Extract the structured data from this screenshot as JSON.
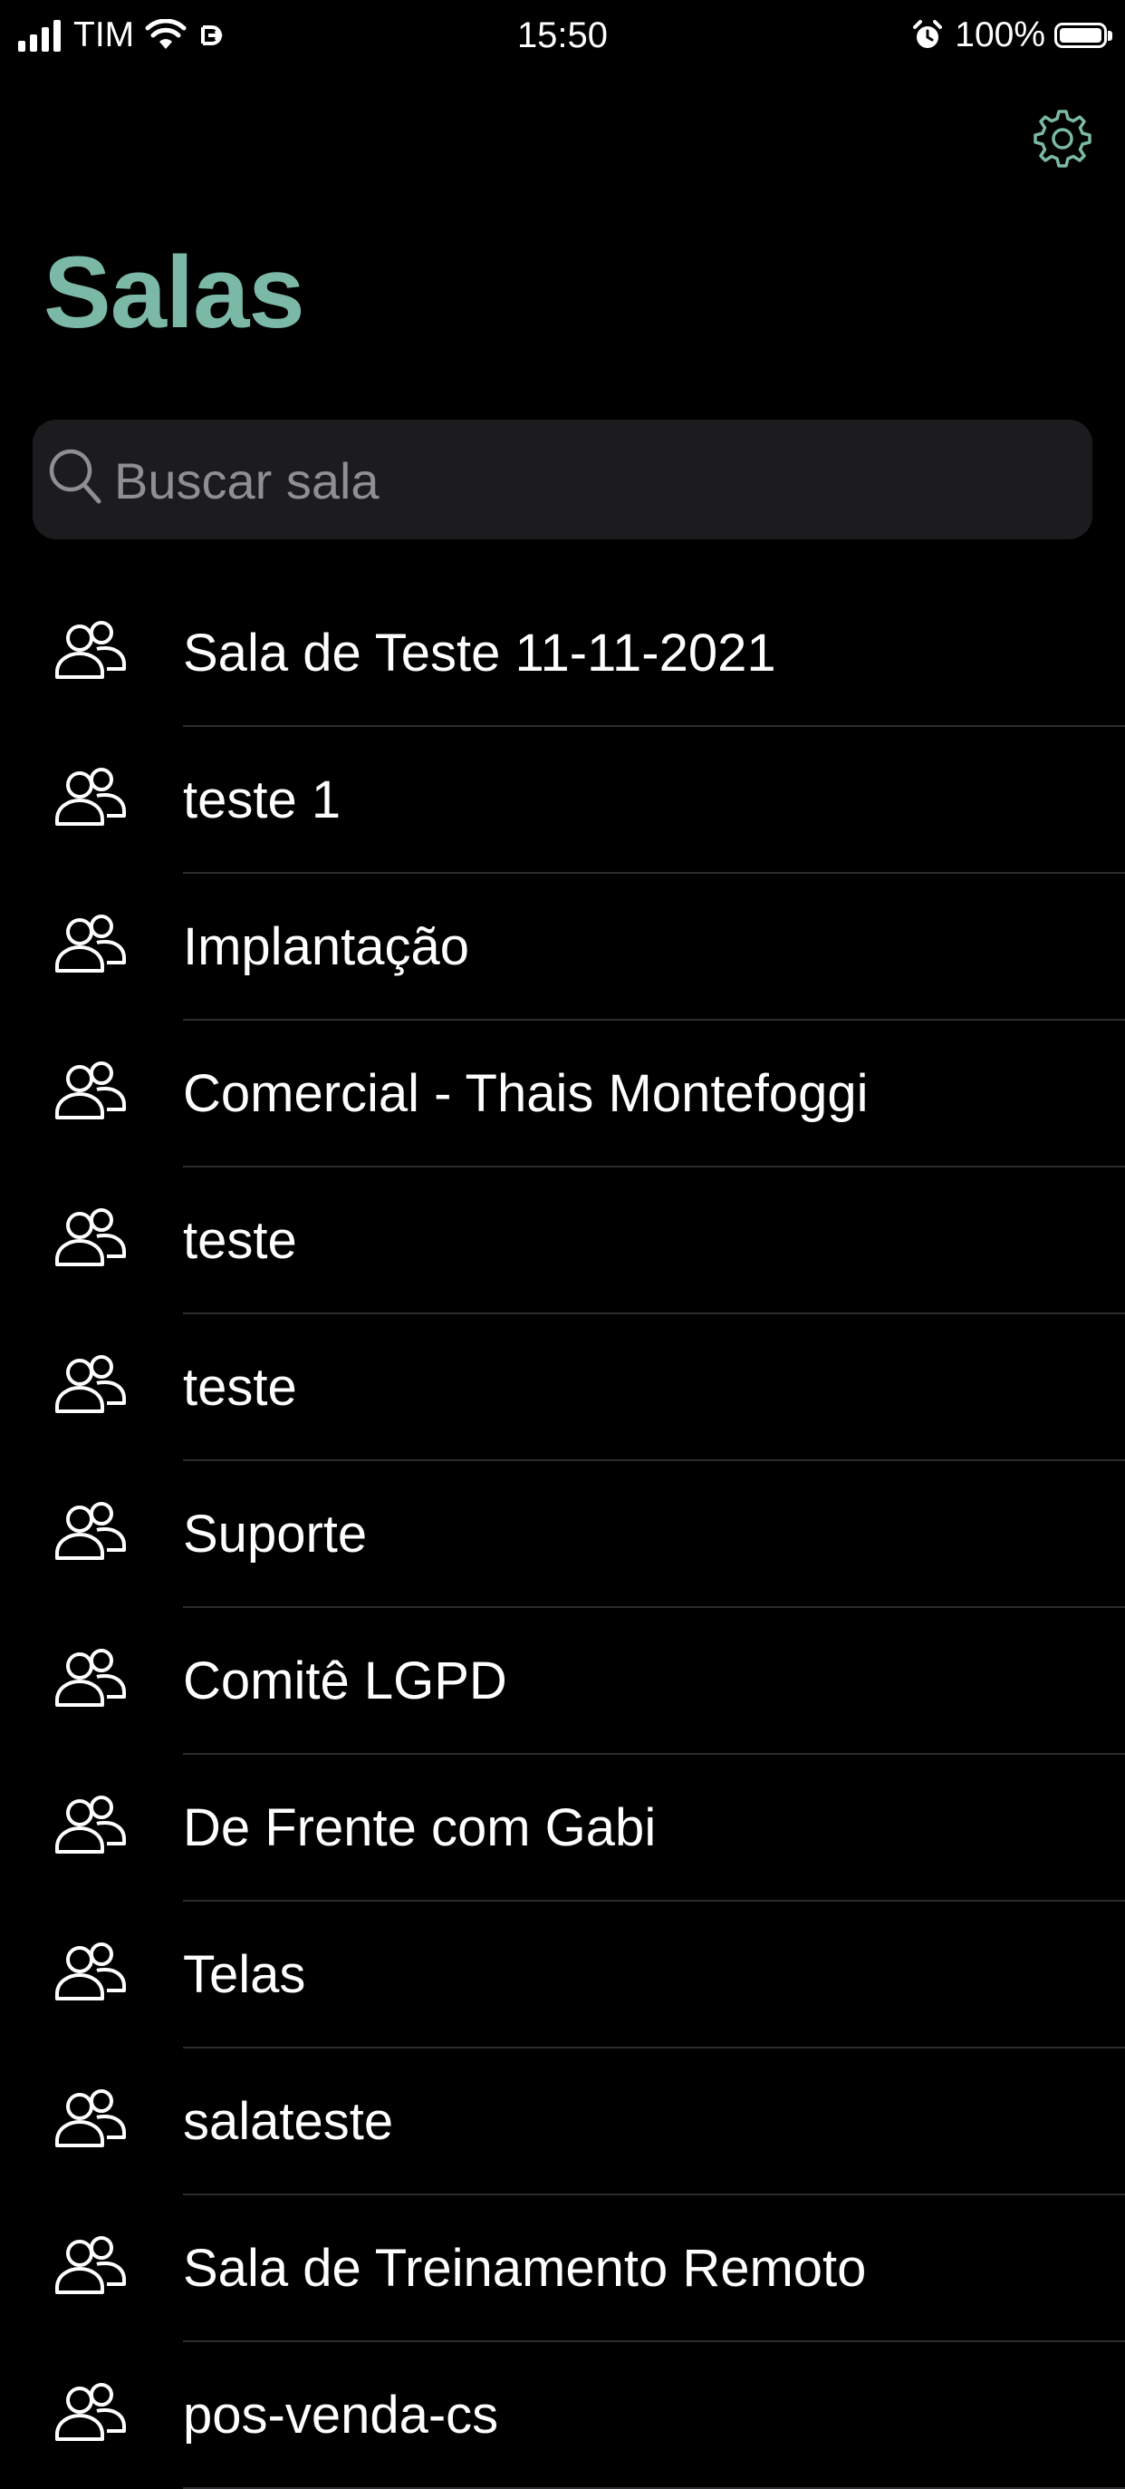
{
  "status_bar": {
    "carrier": "TIM",
    "time": "15:50",
    "battery_percent": "100%"
  },
  "header": {
    "title": "Salas",
    "settings_icon": "gear-icon",
    "accent_color": "#7bb8a6"
  },
  "search": {
    "placeholder": "Buscar sala",
    "value": ""
  },
  "rooms": [
    {
      "name": "Sala de Teste 11-11-2021",
      "icon": "people-icon"
    },
    {
      "name": "teste 1",
      "icon": "people-icon"
    },
    {
      "name": "Implantação",
      "icon": "people-icon"
    },
    {
      "name": "Comercial - Thais Montefoggi",
      "icon": "people-icon"
    },
    {
      "name": "teste",
      "icon": "people-icon"
    },
    {
      "name": "teste",
      "icon": "people-icon"
    },
    {
      "name": "Suporte",
      "icon": "people-icon"
    },
    {
      "name": "Comitê LGPD",
      "icon": "people-icon"
    },
    {
      "name": "De Frente com Gabi",
      "icon": "people-icon"
    },
    {
      "name": "Telas",
      "icon": "people-icon"
    },
    {
      "name": "salateste",
      "icon": "people-icon"
    },
    {
      "name": "Sala de Treinamento Remoto",
      "icon": "people-icon"
    },
    {
      "name": "pos-venda-cs",
      "icon": "people-icon"
    }
  ]
}
